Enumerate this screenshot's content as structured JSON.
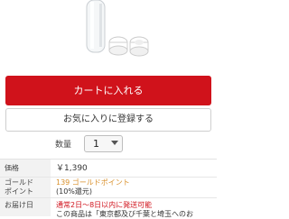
{
  "colors": {
    "primary_red": "#d0121b",
    "gold": "#d9902b",
    "label_bg": "#f2f2f2"
  },
  "product": {
    "image": "product-photo-bottle"
  },
  "actions": {
    "cart_label": "カートに入れる",
    "favorite_label": "お気に入りに登録する"
  },
  "quantity": {
    "label": "数量",
    "value": "1"
  },
  "info": {
    "price_label": "価格",
    "price_value": "￥1,390",
    "points_label_line1": "ゴールド",
    "points_label_line2": "ポイント",
    "points_value": "139 ゴールドポイント",
    "points_note": "(10%還元)",
    "delivery_label": "お届け日",
    "delivery_value": "通常2日〜8日以内に発送可能",
    "delivery_note": "この商品は「東京都及び千葉と埼玉へのお"
  }
}
